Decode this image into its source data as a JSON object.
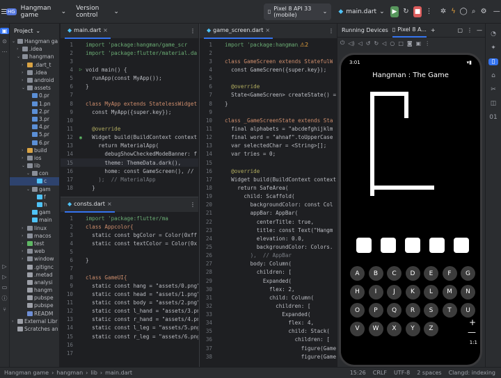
{
  "titlebar": {
    "project_badge": "HG",
    "project_name": "Hangman game",
    "vcs": "Version control",
    "device": "Pixel 8 API 33 (mobile)",
    "run_config": "main.dart"
  },
  "project_panel": {
    "title": "Project",
    "tree": [
      {
        "label": "Hangman ga",
        "indent": 0,
        "kind": "folder",
        "expanded": true
      },
      {
        "label": ".idea",
        "indent": 1,
        "kind": "folder"
      },
      {
        "label": "hangman",
        "indent": 1,
        "kind": "folder",
        "expanded": true
      },
      {
        "label": ".dart_t",
        "indent": 2,
        "kind": "folder-orange"
      },
      {
        "label": ".idea",
        "indent": 2,
        "kind": "folder"
      },
      {
        "label": "android",
        "indent": 2,
        "kind": "folder"
      },
      {
        "label": "assets",
        "indent": 2,
        "kind": "folder",
        "expanded": true
      },
      {
        "label": "0.pr",
        "indent": 3,
        "kind": "img"
      },
      {
        "label": "1.pn",
        "indent": 3,
        "kind": "img"
      },
      {
        "label": "2.pr",
        "indent": 3,
        "kind": "img"
      },
      {
        "label": "3.pr",
        "indent": 3,
        "kind": "img"
      },
      {
        "label": "4.pr",
        "indent": 3,
        "kind": "img"
      },
      {
        "label": "5.pr",
        "indent": 3,
        "kind": "img"
      },
      {
        "label": "6.pr",
        "indent": 3,
        "kind": "img"
      },
      {
        "label": "build",
        "indent": 2,
        "kind": "folder-orange"
      },
      {
        "label": "ios",
        "indent": 2,
        "kind": "folder"
      },
      {
        "label": "lib",
        "indent": 2,
        "kind": "folder",
        "expanded": true
      },
      {
        "label": "con",
        "indent": 3,
        "kind": "folder",
        "expanded": true
      },
      {
        "label": "c",
        "indent": 4,
        "kind": "dart",
        "selected": true
      },
      {
        "label": "gam",
        "indent": 3,
        "kind": "folder",
        "expanded": true
      },
      {
        "label": "f",
        "indent": 4,
        "kind": "dart"
      },
      {
        "label": "h",
        "indent": 4,
        "kind": "dart"
      },
      {
        "label": "gam",
        "indent": 3,
        "kind": "dart"
      },
      {
        "label": "main",
        "indent": 3,
        "kind": "dart"
      },
      {
        "label": "linux",
        "indent": 2,
        "kind": "folder"
      },
      {
        "label": "macos",
        "indent": 2,
        "kind": "folder"
      },
      {
        "label": "test",
        "indent": 2,
        "kind": "folder-green"
      },
      {
        "label": "web",
        "indent": 2,
        "kind": "folder"
      },
      {
        "label": "window",
        "indent": 2,
        "kind": "folder"
      },
      {
        "label": ".gitignc",
        "indent": 2,
        "kind": "file"
      },
      {
        "label": ".metad",
        "indent": 2,
        "kind": "file"
      },
      {
        "label": "analysi",
        "indent": 2,
        "kind": "file"
      },
      {
        "label": "hangm",
        "indent": 2,
        "kind": "file"
      },
      {
        "label": "pubspe",
        "indent": 2,
        "kind": "file"
      },
      {
        "label": "pubspe",
        "indent": 2,
        "kind": "file"
      },
      {
        "label": "READM",
        "indent": 2,
        "kind": "md"
      },
      {
        "label": "External Libr",
        "indent": 0,
        "kind": "lib"
      },
      {
        "label": "Scratches an",
        "indent": 0,
        "kind": "scratch"
      }
    ]
  },
  "main_editor": {
    "tab": "main.dart",
    "lines": [
      {
        "n": "1",
        "t": "import 'package:hangman/game_scr",
        "c": "st"
      },
      {
        "n": "2",
        "t": "import 'package:flutter/material.da",
        "c": "st"
      },
      {
        "n": "3",
        "t": "",
        "c": "cl"
      },
      {
        "n": "4",
        "t": "void main() {",
        "c": "cl",
        "g": "▷"
      },
      {
        "n": "5",
        "t": "  runApp(const MyApp());",
        "c": "cl"
      },
      {
        "n": "6",
        "t": "}",
        "c": "cl"
      },
      {
        "n": "7",
        "t": "",
        "c": "cl"
      },
      {
        "n": "8",
        "t": "class MyApp extends StatelessWidget",
        "c": "kw"
      },
      {
        "n": "9",
        "t": "  const MyApp({super.key});",
        "c": "cl"
      },
      {
        "n": "10",
        "t": "",
        "c": "cl"
      },
      {
        "n": "11",
        "t": "  @override",
        "c": "an"
      },
      {
        "n": "12",
        "t": "  Widget build(BuildContext context",
        "c": "cl",
        "g": "◉"
      },
      {
        "n": "13",
        "t": "    return MaterialApp(",
        "c": "cl"
      },
      {
        "n": "14",
        "t": "      debugShowCheckedModeBanner: f",
        "c": "cl"
      },
      {
        "n": "15",
        "t": "      theme: ThemeData.dark(),",
        "c": "cl"
      },
      {
        "n": "16",
        "t": "      home: const GameScreen(), //",
        "c": "cl"
      },
      {
        "n": "17",
        "t": "    );  // MaterialApp",
        "c": "cm"
      },
      {
        "n": "18",
        "t": "  }",
        "c": "cl"
      }
    ]
  },
  "consts_editor": {
    "tab": "consts.dart",
    "lines": [
      {
        "n": "1",
        "t": "import 'package:flutter/ma",
        "c": "st"
      },
      {
        "n": "2",
        "t": "class Appcolor{",
        "c": "kw"
      },
      {
        "n": "3",
        "t": "  static const bgColor = Color(0xff",
        "c": "cl"
      },
      {
        "n": "4",
        "t": "  static const textColor = Color(0x",
        "c": "cl"
      },
      {
        "n": "5",
        "t": "",
        "c": "cl"
      },
      {
        "n": "6",
        "t": "}",
        "c": "cl"
      },
      {
        "n": "7",
        "t": "",
        "c": "cl"
      },
      {
        "n": "8",
        "t": "class GameUI{",
        "c": "kw"
      },
      {
        "n": "9",
        "t": "  static const hang = \"assets/0.png\"",
        "c": "cl"
      },
      {
        "n": "10",
        "t": "  static const head = \"assets/1.png\"",
        "c": "cl"
      },
      {
        "n": "11",
        "t": "  static const body = \"assets/2.png\"",
        "c": "cl"
      },
      {
        "n": "12",
        "t": "  static const l_hand = \"assets/3.pn",
        "c": "cl"
      },
      {
        "n": "13",
        "t": "  static const r_hand = \"assets/4.pn",
        "c": "cl"
      },
      {
        "n": "14",
        "t": "  static const l_leg = \"assets/5.png",
        "c": "cl"
      },
      {
        "n": "15",
        "t": "  static const r_leg = \"assets/6.png",
        "c": "cl"
      },
      {
        "n": "16",
        "t": "",
        "c": "cl"
      },
      {
        "n": "17",
        "t": "",
        "c": "cl"
      }
    ]
  },
  "game_editor": {
    "tab": "game_screen.dart",
    "problems": "⚠2",
    "lines": [
      {
        "n": "1",
        "t": "import 'package:hangman/co",
        "c": "st"
      },
      {
        "n": "2",
        "t": "",
        "c": "cl"
      },
      {
        "n": "3",
        "t": "class GameScreen extends StatefulW",
        "c": "kw"
      },
      {
        "n": "4",
        "t": "  const GameScreen({super.key});",
        "c": "cl"
      },
      {
        "n": "5",
        "t": "",
        "c": "cl"
      },
      {
        "n": "6",
        "t": "  @override",
        "c": "an"
      },
      {
        "n": "7",
        "t": "  State<GameScreen> createState() =",
        "c": "cl"
      },
      {
        "n": "8",
        "t": "}",
        "c": "cl"
      },
      {
        "n": "9",
        "t": "",
        "c": "cl"
      },
      {
        "n": "10",
        "t": "class _GameScreenState extends Sta",
        "c": "kw"
      },
      {
        "n": "11",
        "t": "  final alphabets = \"abcdefghijklm",
        "c": "cl"
      },
      {
        "n": "12",
        "t": "  final word = \"ahnaf\".toUpperCase",
        "c": "cl"
      },
      {
        "n": "13",
        "t": "  var selectedChar = <String>[];",
        "c": "cl"
      },
      {
        "n": "14",
        "t": "  var tries = 0;",
        "c": "cl"
      },
      {
        "n": "15",
        "t": "",
        "c": "cl"
      },
      {
        "n": "16",
        "t": "  @override",
        "c": "an"
      },
      {
        "n": "17",
        "t": "  Widget build(BuildContext context",
        "c": "cl"
      },
      {
        "n": "18",
        "t": "    return SafeArea(",
        "c": "cl"
      },
      {
        "n": "19",
        "t": "      child: Scaffold(",
        "c": "cl"
      },
      {
        "n": "20",
        "t": "        backgroundColor: const Col",
        "c": "cl"
      },
      {
        "n": "21",
        "t": "        appBar: AppBar(",
        "c": "cl"
      },
      {
        "n": "22",
        "t": "          centerTitle: true,",
        "c": "cl"
      },
      {
        "n": "23",
        "t": "          title: const Text(\"Hangm",
        "c": "cl"
      },
      {
        "n": "24",
        "t": "          elevation: 0.0,",
        "c": "cl"
      },
      {
        "n": "25",
        "t": "          backgroundColor: Colors.",
        "c": "cl"
      },
      {
        "n": "26",
        "t": "        ),  // AppBar",
        "c": "cm"
      },
      {
        "n": "27",
        "t": "        body: Column(",
        "c": "cl"
      },
      {
        "n": "28",
        "t": "          children: [",
        "c": "cl"
      },
      {
        "n": "29",
        "t": "            Expanded(",
        "c": "cl"
      },
      {
        "n": "30",
        "t": "              flex: 2,",
        "c": "cl"
      },
      {
        "n": "31",
        "t": "              child: Column(",
        "c": "cl"
      },
      {
        "n": "32",
        "t": "                children: [",
        "c": "cl"
      },
      {
        "n": "33",
        "t": "                  Expanded(",
        "c": "cl"
      },
      {
        "n": "34",
        "t": "                    flex: 4,",
        "c": "cl"
      },
      {
        "n": "35",
        "t": "                    child: Stack(",
        "c": "cl"
      },
      {
        "n": "36",
        "t": "                      children: [",
        "c": "cl"
      },
      {
        "n": "37",
        "t": "                        figure(Game",
        "c": "cl"
      },
      {
        "n": "38",
        "t": "                        figure(Game",
        "c": "cl"
      }
    ]
  },
  "running_devices": {
    "title": "Running Devices",
    "device_tab": "Pixel 8 A...",
    "phone": {
      "time": "3:01",
      "app_title": "Hangman : The Game",
      "blanks": 5,
      "keys": [
        "A",
        "B",
        "C",
        "D",
        "E",
        "F",
        "G",
        "H",
        "I",
        "J",
        "K",
        "L",
        "M",
        "N",
        "O",
        "P",
        "Q",
        "R",
        "S",
        "T",
        "U",
        "V",
        "W",
        "X",
        "Y",
        "Z"
      ]
    },
    "zoom": "1:1"
  },
  "statusbar": {
    "breadcrumbs": [
      "Hangman game",
      "hangman",
      "lib",
      "main.dart"
    ],
    "position": "15:26",
    "line_ending": "CRLF",
    "encoding": "UTF-8",
    "indent": "2 spaces",
    "indexing": "Clangd: indexing"
  },
  "colors": {
    "accent": "#3574f0",
    "run_green": "#57965c",
    "stop_red": "#db5c5c"
  }
}
